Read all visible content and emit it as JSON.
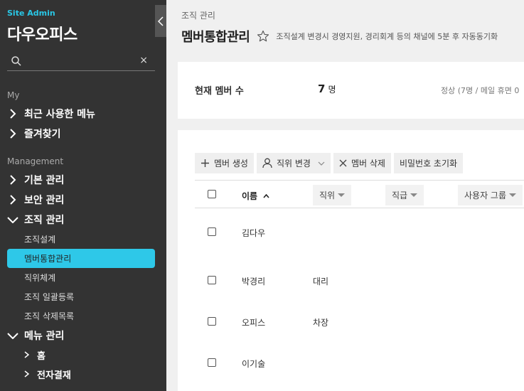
{
  "sidebar": {
    "site_admin": "Site Admin",
    "brand": "다우오피스",
    "search_clear": "×",
    "sections": {
      "my": "My",
      "management": "Management"
    },
    "my_items": [
      "최근 사용한 메뉴",
      "즐겨찾기"
    ],
    "mgmt_items": [
      "기본 관리",
      "보안 관리",
      "조직 관리"
    ],
    "org_sub": [
      "조직설계",
      "멤버통합관리",
      "직위체계",
      "조직 일괄등록",
      "조직 삭제목록"
    ],
    "menu_mgmt": "메뉴 관리",
    "menu_sub": [
      "홈",
      "전자결재"
    ]
  },
  "main": {
    "breadcrumb": "조직 관리",
    "title": "멤버통합관리",
    "description": "조직설계 변경시 경영지원, 경리회계 등의 채널에 5분 후 자동동기화",
    "member_count": {
      "label": "현재 멤버 수",
      "value": "7",
      "unit": "명",
      "status": "정상 (7명 / 메일 휴면 0"
    },
    "toolbar": [
      "멤버 생성",
      "직위 변경",
      "멤버 삭제",
      "비밀번호 초기화"
    ],
    "columns": {
      "name": "이름",
      "position": "직위",
      "rank": "직급",
      "user_group": "사용자 그룹"
    },
    "rows": [
      {
        "name": "김다우",
        "position": ""
      },
      {
        "name": "박경리",
        "position": "대리"
      },
      {
        "name": "오피스",
        "position": "차장"
      },
      {
        "name": "이기술",
        "position": ""
      }
    ]
  },
  "colors": {
    "sidebar_bg": "#333333",
    "accent": "#2ec8e8",
    "page_bg": "#f0f0f0"
  }
}
